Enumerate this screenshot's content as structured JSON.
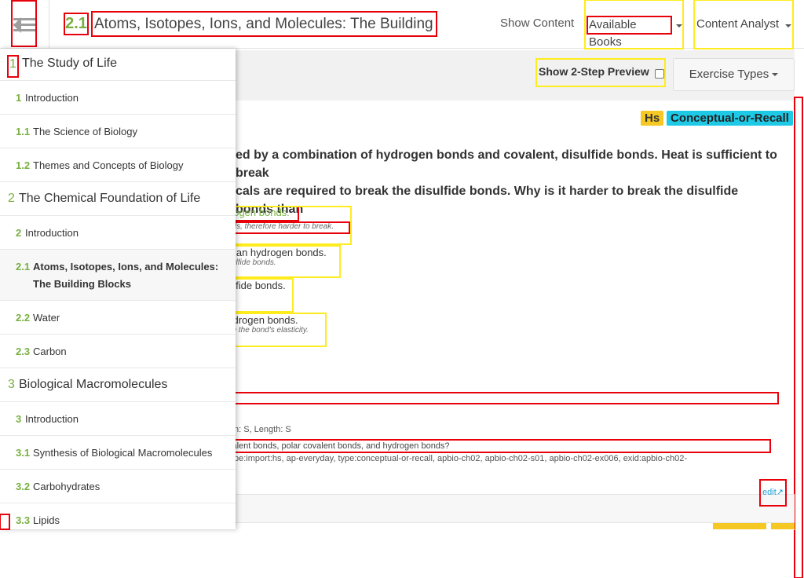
{
  "navbar": {
    "section_number": "2.1",
    "section_title": "Atoms, Isotopes, Ions, and Molecules: The Building Blo...",
    "show_content": "Show Content",
    "available_books": "Available Books",
    "content_analyst": "Content Analyst"
  },
  "toolbar": {
    "preview_label": "Show 2-Step Preview",
    "exercise_types": "Exercise Types"
  },
  "exercise": {
    "tags": [
      "Hs",
      "Conceptual-or-Recall"
    ],
    "question_line1": "ed by a combination of hydrogen bonds and covalent, disulfide bonds. Heat is sufficient to break",
    "question_line2": "cals are required to break the disulfide bonds. Why is it harder to break the disulfide bonds than",
    "answers": [
      {
        "text": "lrogen bonds.",
        "feedback": "nds, therefore harder to break."
      },
      {
        "text": "than hydrogen bonds.",
        "feedback": "sulfide bonds."
      },
      {
        "text": "ulfide bonds.",
        "feedback": ""
      },
      {
        "text": "ydrogen bonds.",
        "feedback": "on the bond's elasticity."
      }
    ],
    "meta": "n: S,    Length: S",
    "prompt": "valent bonds, polar covalent bonds, and hydrogen bonds?",
    "tags_row": "pe:import:hs,    ap-everyday,    type:conceptual-or-recall,    apbio-ch02,    apbio-ch02-s01,    apbio-ch02-ex006,    exid:apbio-ch02-",
    "edit_label": "edit"
  },
  "sidebar": {
    "items": [
      {
        "kind": "chapter",
        "num": "1",
        "label": "The Study of Life"
      },
      {
        "kind": "section",
        "num": "1",
        "label": "Introduction"
      },
      {
        "kind": "section",
        "num": "1.1",
        "label": "The Science of Biology"
      },
      {
        "kind": "section",
        "num": "1.2",
        "label": "Themes and Concepts of Biology"
      },
      {
        "kind": "chapter",
        "num": "2",
        "label": "The Chemical Foundation of Life"
      },
      {
        "kind": "section",
        "num": "2",
        "label": "Introduction"
      },
      {
        "kind": "section",
        "num": "2.1",
        "label": "Atoms, Isotopes, Ions, and Molecules:",
        "label2": "The Building Blocks",
        "active": true
      },
      {
        "kind": "section",
        "num": "2.2",
        "label": "Water"
      },
      {
        "kind": "section",
        "num": "2.3",
        "label": "Carbon"
      },
      {
        "kind": "chapter",
        "num": "3",
        "label": "Biological Macromolecules"
      },
      {
        "kind": "section",
        "num": "3",
        "label": "Introduction"
      },
      {
        "kind": "section",
        "num": "3.1",
        "label": "Synthesis of Biological Macromolecules"
      },
      {
        "kind": "section",
        "num": "3.2",
        "label": "Carbohydrates"
      },
      {
        "kind": "section",
        "num": "3.3",
        "label": "Lipids"
      }
    ]
  },
  "colors": {
    "accent_green": "#78b040",
    "tag_yellow": "#f5c823",
    "tag_cyan": "#1ec9e6",
    "highlight_red": "#e8000b",
    "highlight_yellow": "#ffec1e"
  }
}
